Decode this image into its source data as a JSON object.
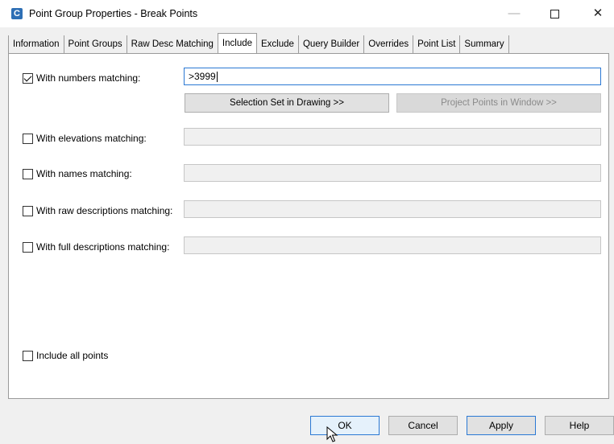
{
  "window": {
    "icon_letter": "C",
    "title": "Point Group Properties - Break Points",
    "minimize_glyph": "—",
    "close_glyph": "✕"
  },
  "tabs": [
    {
      "label": "Information"
    },
    {
      "label": "Point Groups"
    },
    {
      "label": "Raw Desc Matching"
    },
    {
      "label": "Include",
      "active": true
    },
    {
      "label": "Exclude"
    },
    {
      "label": "Query Builder"
    },
    {
      "label": "Overrides"
    },
    {
      "label": "Point List"
    },
    {
      "label": "Summary"
    }
  ],
  "include": {
    "numbers": {
      "label": "With numbers matching:",
      "checked": true,
      "value": ">3999"
    },
    "selection_button": "Selection Set in Drawing >>",
    "project_button": "Project Points in Window >>",
    "elevations": {
      "label": "With elevations matching:",
      "checked": false,
      "value": ""
    },
    "names": {
      "label": "With names matching:",
      "checked": false,
      "value": ""
    },
    "raw_desc": {
      "label": "With raw descriptions matching:",
      "checked": false,
      "value": ""
    },
    "full_desc": {
      "label": "With full descriptions matching:",
      "checked": false,
      "value": ""
    },
    "include_all": {
      "label": "Include all points",
      "checked": false
    }
  },
  "footer": {
    "ok": "OK",
    "cancel": "Cancel",
    "apply": "Apply",
    "help": "Help"
  },
  "colors": {
    "accent": "#2a78d4",
    "app_icon": "#2e6fb5"
  }
}
